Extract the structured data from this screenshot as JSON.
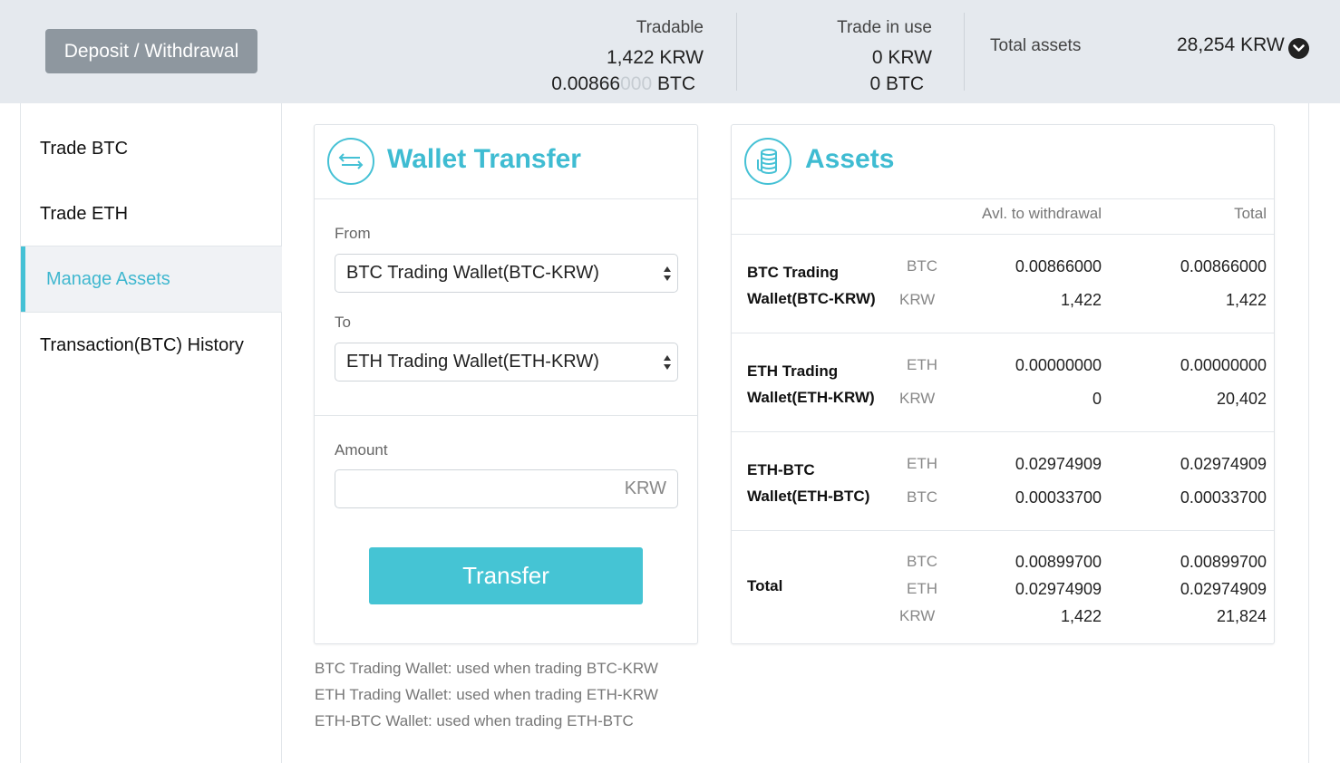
{
  "header": {
    "deposit_label": "Deposit / Withdrawal",
    "tradable_label": "Tradable",
    "tradable_krw": "1,422 KRW",
    "tradable_btc_main": "0.00866",
    "tradable_btc_dim": "000",
    "tradable_btc_unit": " BTC",
    "in_use_label": "Trade in use",
    "in_use_krw": "0 KRW",
    "in_use_btc": "0 BTC",
    "total_label": "Total assets",
    "total_value": "28,254 KRW",
    "accent_color": "#45c1d5"
  },
  "sidebar": {
    "items": [
      {
        "label": "Trade BTC"
      },
      {
        "label": "Trade ETH"
      },
      {
        "label": "Manage Assets"
      },
      {
        "label": "Transaction(BTC) History"
      }
    ],
    "active_index": 2
  },
  "transfer": {
    "title": "Wallet Transfer",
    "from_label": "From",
    "from_value": "BTC Trading Wallet(BTC-KRW)",
    "to_label": "To",
    "to_value": "ETH Trading Wallet(ETH-KRW)",
    "amount_label": "Amount",
    "amount_unit": "KRW",
    "button_label": "Transfer"
  },
  "notes": [
    "BTC Trading Wallet: used when trading BTC-KRW",
    "ETH Trading Wallet: used when trading ETH-KRW",
    "ETH-BTC Wallet: used when trading ETH-BTC"
  ],
  "assets": {
    "title": "Assets",
    "col_avl": "Avl. to withdrawal",
    "col_total": "Total",
    "rows": [
      {
        "name_1": "BTC Trading",
        "name_2": "Wallet(BTC-KRW)",
        "cur": [
          "BTC",
          "KRW"
        ],
        "avl": [
          "0.00866000",
          "1,422"
        ],
        "total": [
          "0.00866000",
          "1,422"
        ]
      },
      {
        "name_1": "ETH Trading",
        "name_2": "Wallet(ETH-KRW)",
        "cur": [
          "ETH",
          "KRW"
        ],
        "avl": [
          "0.00000000",
          "0"
        ],
        "total": [
          "0.00000000",
          "20,402"
        ]
      },
      {
        "name_1": "ETH-BTC",
        "name_2": "Wallet(ETH-BTC)",
        "cur": [
          "ETH",
          "BTC"
        ],
        "avl": [
          "0.02974909",
          "0.00033700"
        ],
        "total": [
          "0.02974909",
          "0.00033700"
        ]
      }
    ],
    "total_row": {
      "name": "Total",
      "cur": [
        "BTC",
        "ETH",
        "KRW"
      ],
      "avl": [
        "0.00899700",
        "0.02974909",
        "1,422"
      ],
      "total": [
        "0.00899700",
        "0.02974909",
        "21,824"
      ]
    }
  }
}
